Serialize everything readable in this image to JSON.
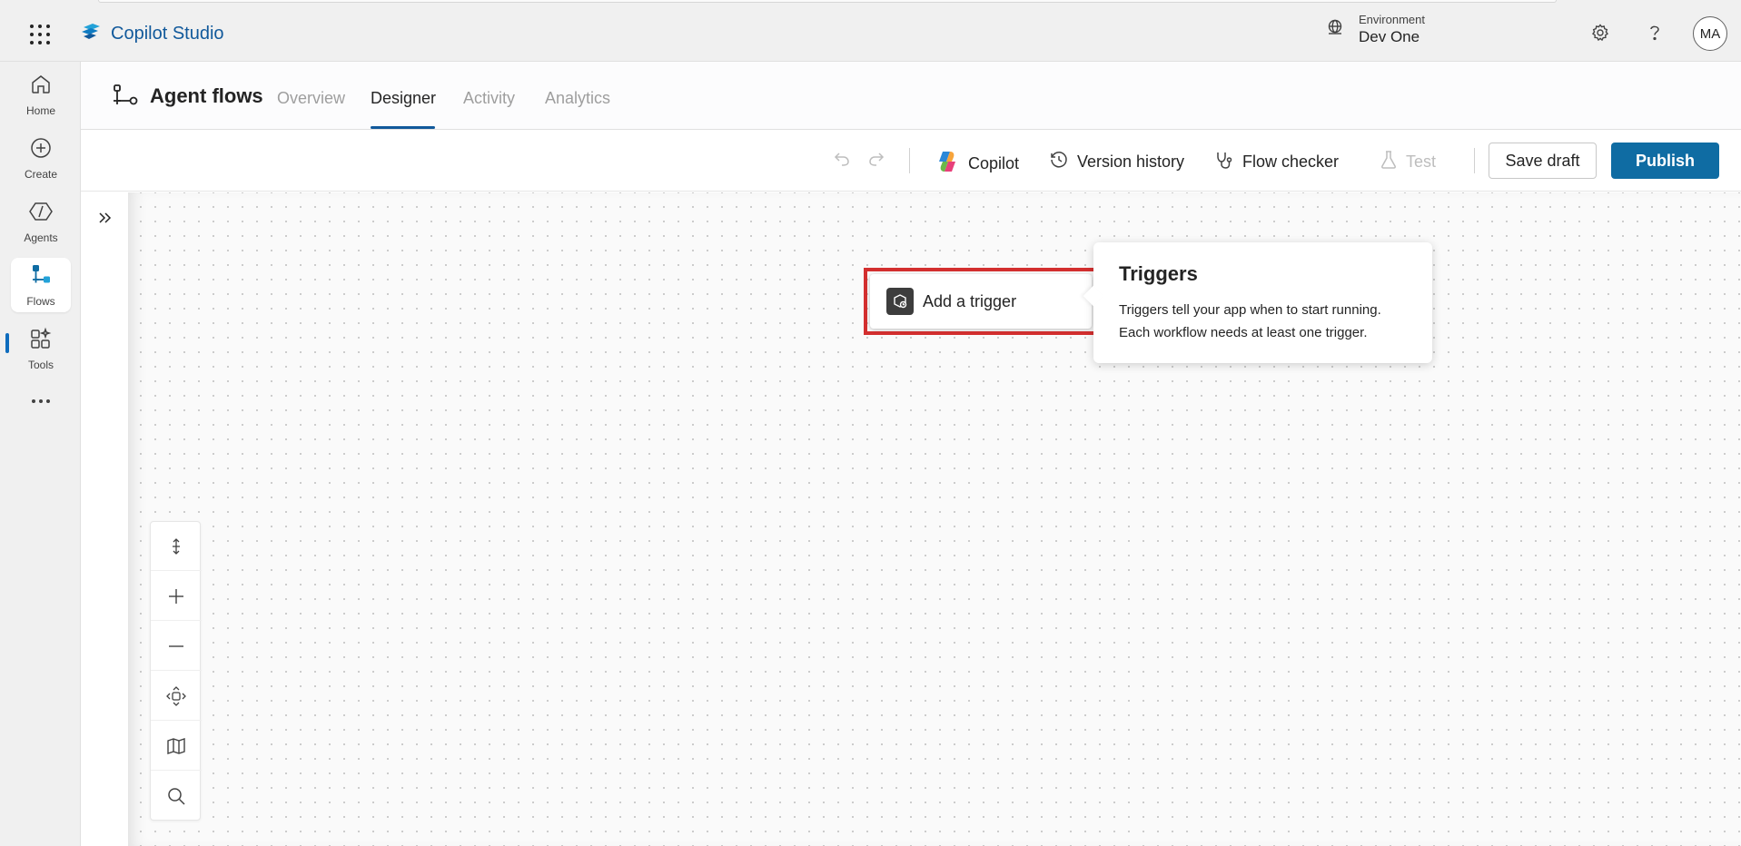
{
  "app": {
    "name": "Copilot Studio",
    "environment_label": "Environment",
    "environment_value": "Dev One",
    "avatar_initials": "MA"
  },
  "icons": {
    "menu": "waffle-icon",
    "settings": "gear-icon",
    "help": "question-icon",
    "environment": "globe-icon"
  },
  "nav": {
    "items": [
      {
        "label": "Home",
        "icon": "home-icon"
      },
      {
        "label": "Create",
        "icon": "plus-circle-icon"
      },
      {
        "label": "Agents",
        "icon": "agent-icon"
      },
      {
        "label": "Flows",
        "icon": "flow-icon",
        "active": true
      },
      {
        "label": "Tools",
        "icon": "tools-icon"
      }
    ],
    "more": "more-icon"
  },
  "page": {
    "title": "Agent flows",
    "tabs": [
      {
        "label": "Overview"
      },
      {
        "label": "Designer",
        "active": true
      },
      {
        "label": "Activity"
      },
      {
        "label": "Analytics"
      }
    ]
  },
  "toolbar": {
    "copilot": "Copilot",
    "version_history": "Version history",
    "flow_checker": "Flow checker",
    "test": "Test",
    "save_draft": "Save draft",
    "publish": "Publish"
  },
  "canvas": {
    "trigger_label": "Add a trigger",
    "callout_title": "Triggers",
    "callout_line1": "Triggers tell your app when to start running.",
    "callout_line2": "Each workflow needs at least one trigger."
  },
  "colors": {
    "accent": "#0f6ca3",
    "highlight": "#d32f2f",
    "brand_text": "#11599b"
  }
}
